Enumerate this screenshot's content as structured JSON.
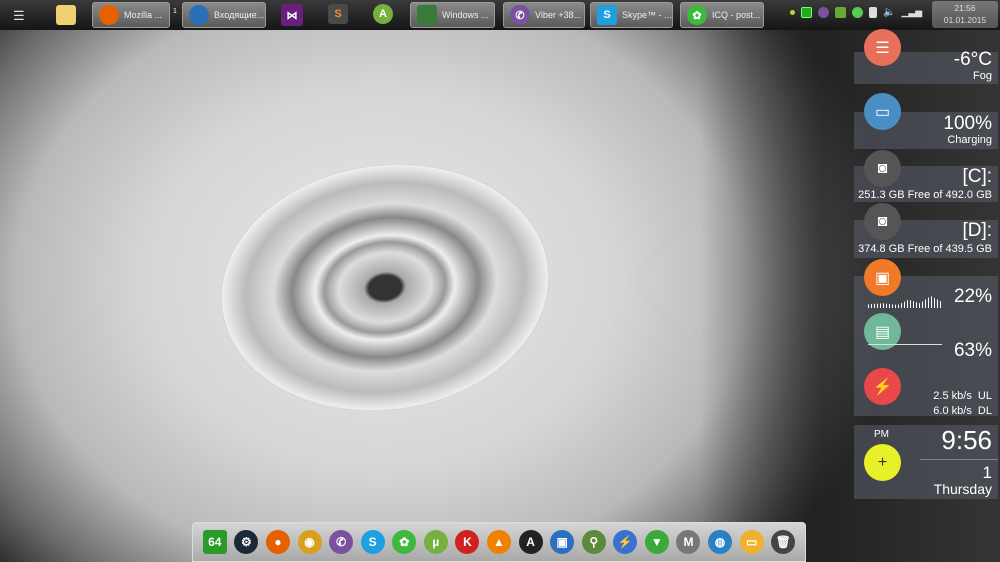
{
  "taskbar": {
    "menu_icon": "menu-icon",
    "items": [
      {
        "label": "Mozilla ...",
        "icon": "firefox-icon",
        "color": "#e66000"
      },
      {
        "label": "Входящие...",
        "icon": "thunderbird-icon",
        "color": "#2a6fb8"
      },
      {
        "label": "Windows ...",
        "icon": "windows-console-icon",
        "color": "#3a7a3a"
      },
      {
        "label": "Viber +38...",
        "icon": "viber-icon",
        "color": "#7b519d"
      },
      {
        "label": "Skype™ - ...",
        "icon": "skype-icon",
        "color": "#1ea0e0"
      },
      {
        "label": "ICQ - post...",
        "icon": "icq-icon",
        "color": "#3cba3c"
      }
    ],
    "badge": "1",
    "clock_time": "21:56",
    "clock_date": "01.01.2015"
  },
  "widgets": {
    "weather": {
      "temp": "-6°C",
      "condition": "Fog",
      "color": "#e8705a"
    },
    "battery": {
      "value": "100%",
      "status": "Charging",
      "color": "#4a8fc4"
    },
    "drive_c": {
      "label": "[C]:",
      "detail": "251.3 GB Free of 492.0 GB"
    },
    "drive_d": {
      "label": "[D]:",
      "detail": "374.8 GB Free of 439.5 GB"
    },
    "cpu": {
      "value": "22%",
      "color": "#f07a2a"
    },
    "ram": {
      "value": "63%",
      "fraction": 0.63,
      "color": "#6fb89a"
    },
    "network": {
      "ul": "2.5 kb/s  UL",
      "dl": "6.0 kb/s  DL",
      "color": "#e84848"
    },
    "time": {
      "ampm": "PM",
      "time": "9:56",
      "day": "1",
      "weekday": "Thursday"
    },
    "add": {
      "label": "+",
      "color": "#e8f02a"
    }
  },
  "dock": [
    {
      "name": "aida64",
      "glyph": "64",
      "color": "#2a9a2a"
    },
    {
      "name": "steam",
      "glyph": "⚙",
      "color": "#1b2838"
    },
    {
      "name": "firefox",
      "glyph": "●",
      "color": "#e66000"
    },
    {
      "name": "chrome",
      "glyph": "◉",
      "color": "#d9a020"
    },
    {
      "name": "viber",
      "glyph": "✆",
      "color": "#7b519d"
    },
    {
      "name": "skype",
      "glyph": "S",
      "color": "#1ea0e0"
    },
    {
      "name": "icq",
      "glyph": "✿",
      "color": "#3cba3c"
    },
    {
      "name": "utorrent",
      "glyph": "µ",
      "color": "#78b040"
    },
    {
      "name": "kaspersky",
      "glyph": "K",
      "color": "#d02020"
    },
    {
      "name": "vlc",
      "glyph": "▲",
      "color": "#f08000"
    },
    {
      "name": "aimp",
      "glyph": "A",
      "color": "#222"
    },
    {
      "name": "virtualbox",
      "glyph": "▣",
      "color": "#2a70c0"
    },
    {
      "name": "search-tool",
      "glyph": "⚲",
      "color": "#5a8a3a"
    },
    {
      "name": "thunderbolt",
      "glyph": "⚡",
      "color": "#3a70d0"
    },
    {
      "name": "network-tool",
      "glyph": "▼",
      "color": "#3aaa3a"
    },
    {
      "name": "m-app",
      "glyph": "M",
      "color": "#777"
    },
    {
      "name": "globe",
      "glyph": "◍",
      "color": "#2a80c0"
    },
    {
      "name": "folder",
      "glyph": "▭",
      "color": "#f0b030"
    },
    {
      "name": "trash",
      "glyph": "🗑",
      "color": "#444"
    }
  ]
}
